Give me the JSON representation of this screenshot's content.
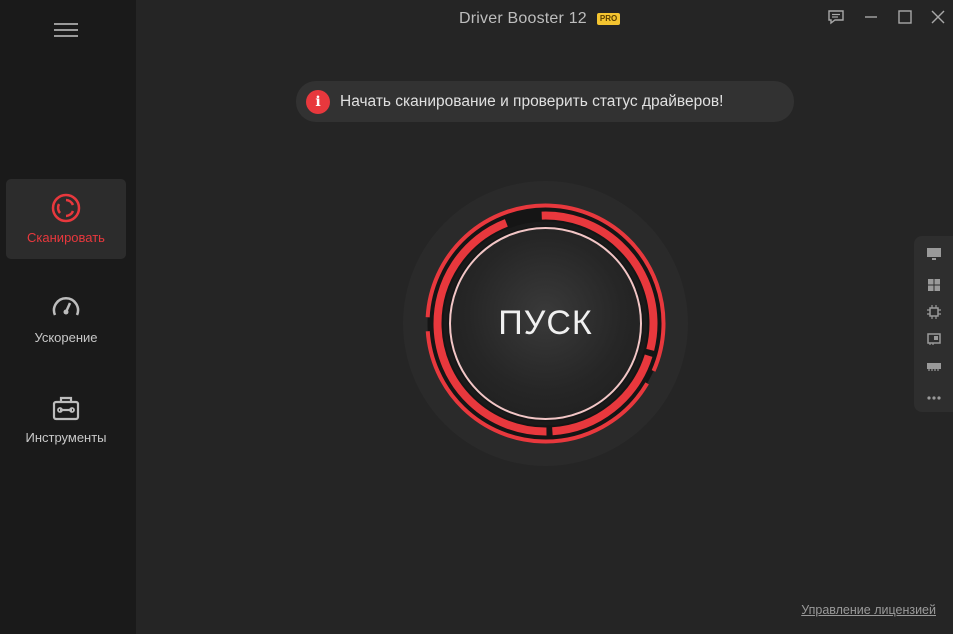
{
  "app": {
    "title": "Driver Booster 12",
    "badge": "PRO"
  },
  "sidebar": {
    "menu_icon": "hamburger-menu-icon",
    "items": [
      {
        "label": "Сканировать",
        "icon": "scan-icon",
        "active": true
      },
      {
        "label": "Ускорение",
        "icon": "speedometer-icon",
        "active": false
      },
      {
        "label": "Инструменты",
        "icon": "toolbox-icon",
        "active": false
      }
    ]
  },
  "window_controls": [
    "feedback-icon",
    "minimize-icon",
    "maximize-icon",
    "close-icon"
  ],
  "notice": {
    "icon": "info-icon",
    "icon_glyph": "i",
    "text": "Начать сканирование и проверить статус драйверов!"
  },
  "scan_button": {
    "label": "ПУСК"
  },
  "side_panel": {
    "icons": [
      "monitor-icon",
      "windows-icon",
      "chip-icon",
      "network-card-icon",
      "memory-icon",
      "more-icon"
    ]
  },
  "footer": {
    "license_link": "Управление лицензией"
  },
  "colors": {
    "accent": "#e8383d",
    "background": "#252525",
    "sidebar": "#1a1a1a",
    "badge": "#f4c430"
  }
}
